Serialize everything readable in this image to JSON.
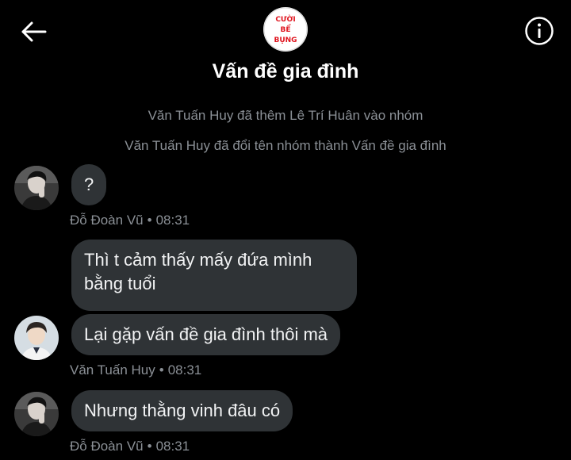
{
  "header": {
    "title": "Vấn đề gia đình",
    "group_avatar": {
      "line1": "CƯỜI",
      "line2": "BỂ",
      "line3": "BỤNG"
    },
    "back_icon": "arrow-left-icon",
    "info_icon": "info-circle-icon"
  },
  "system_messages": [
    "Văn Tuấn Huy đã thêm Lê Trí Huân vào nhóm",
    "Văn Tuấn Huy đã đổi tên nhóm thành Vấn đề gia đình"
  ],
  "messages": [
    {
      "text": "?"
    },
    {
      "text_line1": "Thì t cảm thấy mấy đứa mình",
      "text_line2": "bằng tuổi"
    },
    {
      "text": "Lại gặp vấn đề gia đình thôi mà"
    },
    {
      "text": "Nhưng thằng vinh đâu có"
    }
  ],
  "meta": [
    {
      "sender": "Đỗ Đoàn Vũ",
      "separator": "•",
      "time": "08:31"
    },
    {
      "sender": "Văn Tuấn Huy",
      "separator": "•",
      "time": "08:31"
    },
    {
      "sender": "Đỗ Đoàn Vũ",
      "separator": "•",
      "time": "08:31"
    }
  ],
  "colors": {
    "background": "#000000",
    "bubble": "#2f3336",
    "secondary_text": "#8b9096",
    "logo_red": "#e0141e"
  }
}
